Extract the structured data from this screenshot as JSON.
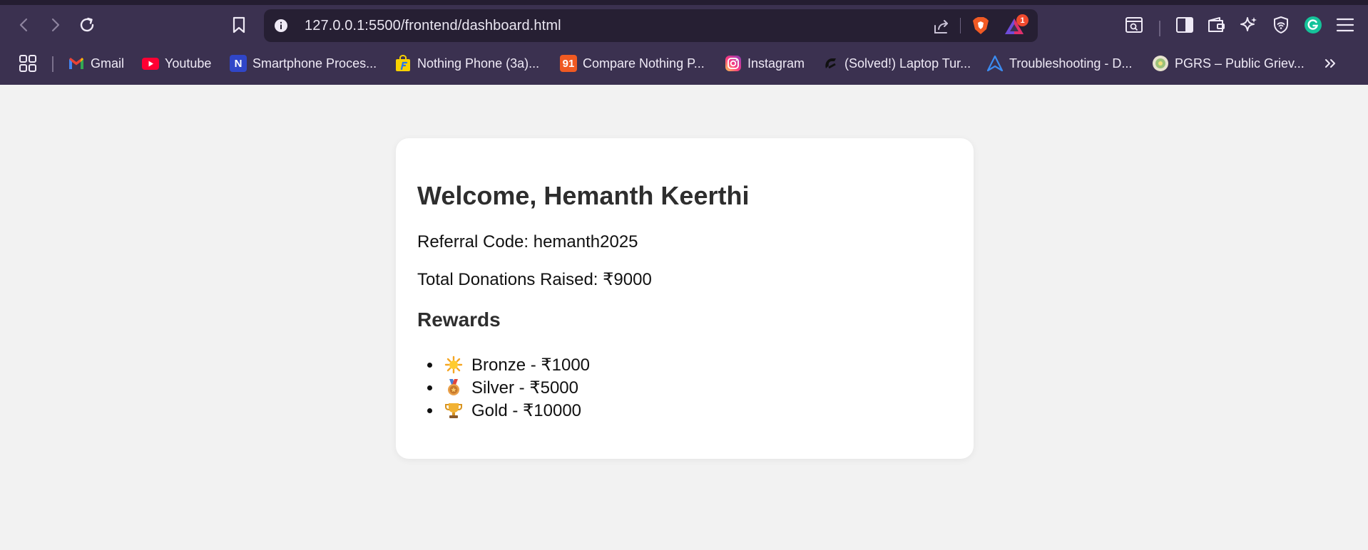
{
  "browser": {
    "url": "127.0.0.1:5500/frontend/dashboard.html",
    "rewards_badge_count": "1",
    "bookmarks": [
      {
        "label": "Gmail",
        "icon": "gmail-icon"
      },
      {
        "label": "Youtube",
        "icon": "youtube-icon"
      },
      {
        "label": "Smartphone Proces...",
        "icon": "nanoreview-icon"
      },
      {
        "label": "Nothing Phone (3a)...",
        "icon": "flipkart-icon"
      },
      {
        "label": "Compare Nothing P...",
        "icon": "91mobiles-icon"
      },
      {
        "label": "Instagram",
        "icon": "instagram-icon"
      },
      {
        "label": "(Solved!) Laptop Tur...",
        "icon": "tomshardware-icon"
      },
      {
        "label": "Troubleshooting - D...",
        "icon": "arch-icon"
      },
      {
        "label": "PGRS – Public Griev...",
        "icon": "pgrs-emblem-icon"
      }
    ],
    "bm_glyphs": {
      "nanoreview": "N",
      "mobiles91": "91"
    }
  },
  "dashboard": {
    "welcome": "Welcome, Hemanth Keerthi",
    "referral_line": "Referral Code: hemanth2025",
    "donations_line": "Total Donations Raised: ₹9000",
    "rewards_title": "Rewards",
    "rewards": [
      {
        "label": "Bronze - ₹1000",
        "icon": "sun-icon"
      },
      {
        "label": "Silver - ₹5000",
        "icon": "medal-icon"
      },
      {
        "label": "Gold - ₹10000",
        "icon": "trophy-icon"
      }
    ]
  }
}
